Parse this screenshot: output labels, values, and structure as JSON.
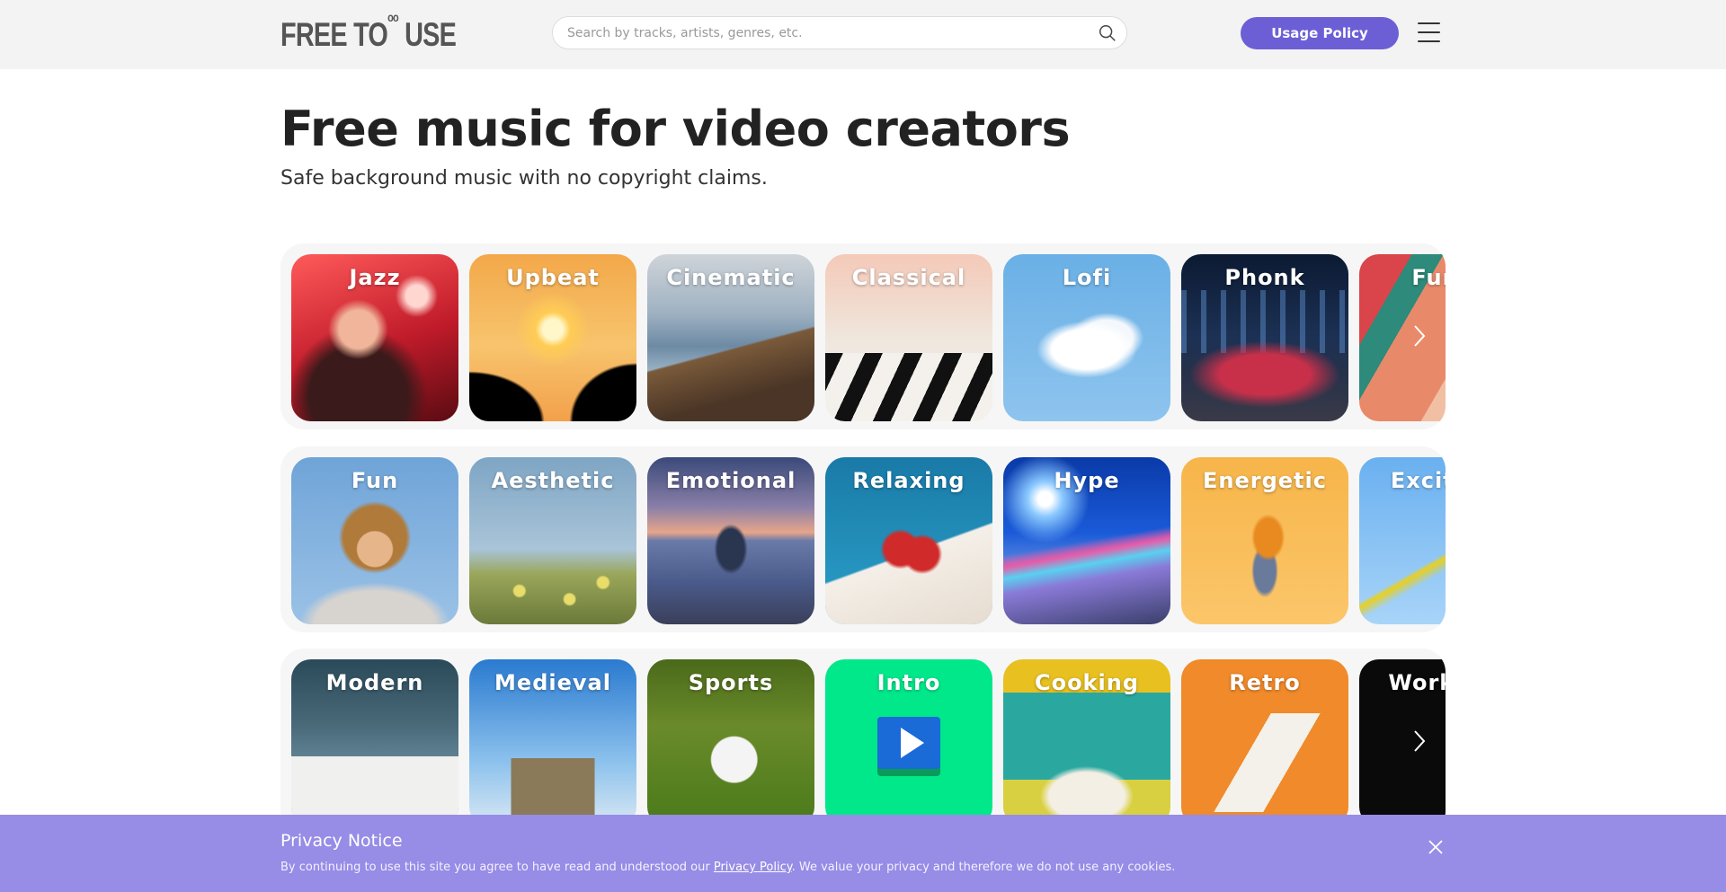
{
  "header": {
    "logo_text": "FREE TO",
    "logo_sup": "oo",
    "logo_end": "USE",
    "search_placeholder": "Search by tracks, artists, genres, etc.",
    "usage_button": "Usage Policy",
    "icons": [
      "search-icon",
      "hamburger-menu-icon"
    ]
  },
  "hero": {
    "title": "Free music for video creators",
    "subtitle": "Safe background music with no copyright claims."
  },
  "rows": [
    {
      "tiles": [
        "Jazz",
        "Upbeat",
        "Cinematic",
        "Classical",
        "Lofi",
        "Phonk",
        "Funk"
      ]
    },
    {
      "tiles": [
        "Fun",
        "Aesthetic",
        "Emotional",
        "Relaxing",
        "Hype",
        "Energetic",
        "Exciting"
      ]
    },
    {
      "tiles": [
        "Modern",
        "Medieval",
        "Sports",
        "Intro",
        "Cooking",
        "Retro",
        "Workout"
      ]
    }
  ],
  "privacy": {
    "title": "Privacy Notice",
    "text_before": "By continuing to use this site you agree to have read and understood our ",
    "link": "Privacy Policy",
    "text_after": ". We value your privacy and therefore we do not use any cookies."
  },
  "colors": {
    "accent": "#6c5fd6",
    "privacy_bg": "#978ce6",
    "header_bg": "#f3f3f3"
  }
}
